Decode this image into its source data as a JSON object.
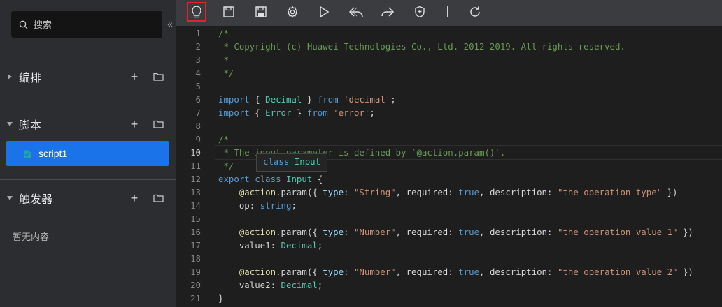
{
  "sidebar": {
    "search_placeholder": "搜索",
    "sections": [
      {
        "title": "编排",
        "expanded": false
      },
      {
        "title": "脚本",
        "expanded": true,
        "items": [
          "script1"
        ]
      },
      {
        "title": "触发器",
        "expanded": true,
        "empty_text": "暂无内容"
      }
    ]
  },
  "toolbar": {
    "icons": [
      "lightbulb-icon",
      "save-icon",
      "save-all-icon",
      "settings-icon",
      "run-icon",
      "undo-icon",
      "redo-icon",
      "shield-icon",
      "separator",
      "refresh-icon"
    ],
    "active": "lightbulb-icon"
  },
  "editor": {
    "lines": [
      {
        "n": "1",
        "tokens": [
          [
            "cm",
            "/*"
          ]
        ]
      },
      {
        "n": "2",
        "tokens": [
          [
            "cm",
            " * Copyright (c) Huawei Technologies Co., Ltd. 2012-2019. All rights reserved."
          ]
        ]
      },
      {
        "n": "3",
        "tokens": [
          [
            "cm",
            " *"
          ]
        ]
      },
      {
        "n": "4",
        "tokens": [
          [
            "cm",
            " */"
          ]
        ]
      },
      {
        "n": "5",
        "tokens": []
      },
      {
        "n": "6",
        "tokens": [
          [
            "kw",
            "import"
          ],
          [
            "",
            "{ "
          ],
          [
            "ty",
            "Decimal"
          ],
          [
            "",
            " } "
          ],
          [
            "kw",
            "from"
          ],
          [
            "",
            " "
          ],
          [
            "str",
            "'decimal'"
          ],
          [
            "",
            ";"
          ]
        ]
      },
      {
        "n": "7",
        "tokens": [
          [
            "kw",
            "import"
          ],
          [
            "",
            "{ "
          ],
          [
            "ty",
            "Error"
          ],
          [
            "",
            " } "
          ],
          [
            "kw",
            "from"
          ],
          [
            "",
            " "
          ],
          [
            "str",
            "'error'"
          ],
          [
            "",
            ";"
          ]
        ]
      },
      {
        "n": "8",
        "tokens": []
      },
      {
        "n": "9",
        "tokens": [
          [
            "cm",
            "/*"
          ]
        ]
      },
      {
        "n": "10",
        "tokens": [
          [
            "cm",
            " * The input parameter is defined by `@action.param()`."
          ]
        ]
      },
      {
        "n": "11",
        "tokens": [
          [
            "cm",
            " */"
          ]
        ]
      },
      {
        "n": "12",
        "tokens": [
          [
            "kw",
            "export"
          ],
          [
            "",
            " "
          ],
          [
            "kw",
            "class"
          ],
          [
            "",
            " "
          ],
          [
            "ty",
            "Input"
          ],
          [
            "",
            " {"
          ]
        ]
      },
      {
        "n": "13",
        "tokens": [
          [
            "",
            "    "
          ],
          [
            "dec",
            "@action"
          ],
          [
            "",
            ".param({ "
          ],
          [
            "prop",
            "type"
          ],
          [
            "",
            ": "
          ],
          [
            "str",
            "\"String\""
          ],
          [
            "",
            ", required: "
          ],
          [
            "kw",
            "true"
          ],
          [
            "",
            ", description: "
          ],
          [
            "str",
            "\"the operation type\""
          ],
          [
            "",
            " })"
          ]
        ]
      },
      {
        "n": "14",
        "tokens": [
          [
            "",
            "    op: "
          ],
          [
            "kw",
            "string"
          ],
          [
            "",
            ";"
          ]
        ]
      },
      {
        "n": "15",
        "tokens": []
      },
      {
        "n": "16",
        "tokens": [
          [
            "",
            "    "
          ],
          [
            "dec",
            "@action"
          ],
          [
            "",
            ".param({ "
          ],
          [
            "prop",
            "type"
          ],
          [
            "",
            ": "
          ],
          [
            "str",
            "\"Number\""
          ],
          [
            "",
            ", required: "
          ],
          [
            "kw",
            "true"
          ],
          [
            "",
            ", description: "
          ],
          [
            "str",
            "\"the operation value 1\""
          ],
          [
            "",
            " })"
          ]
        ]
      },
      {
        "n": "17",
        "tokens": [
          [
            "",
            "    value1: "
          ],
          [
            "ty",
            "Decimal"
          ],
          [
            "",
            ";"
          ]
        ]
      },
      {
        "n": "18",
        "tokens": []
      },
      {
        "n": "19",
        "tokens": [
          [
            "",
            "    "
          ],
          [
            "dec",
            "@action"
          ],
          [
            "",
            ".param({ "
          ],
          [
            "prop",
            "type"
          ],
          [
            "",
            ": "
          ],
          [
            "str",
            "\"Number\""
          ],
          [
            "",
            ", required: "
          ],
          [
            "kw",
            "true"
          ],
          [
            "",
            ", description: "
          ],
          [
            "str",
            "\"the operation value 2\""
          ],
          [
            "",
            " })"
          ]
        ]
      },
      {
        "n": "20",
        "tokens": [
          [
            "",
            "    value2: "
          ],
          [
            "ty",
            "Decimal"
          ],
          [
            "",
            ";"
          ]
        ]
      },
      {
        "n": "21",
        "tokens": [
          [
            "",
            "}"
          ]
        ]
      }
    ],
    "current_line": "10",
    "hover_tooltip": {
      "keyword": "class",
      "name": "Input"
    }
  }
}
